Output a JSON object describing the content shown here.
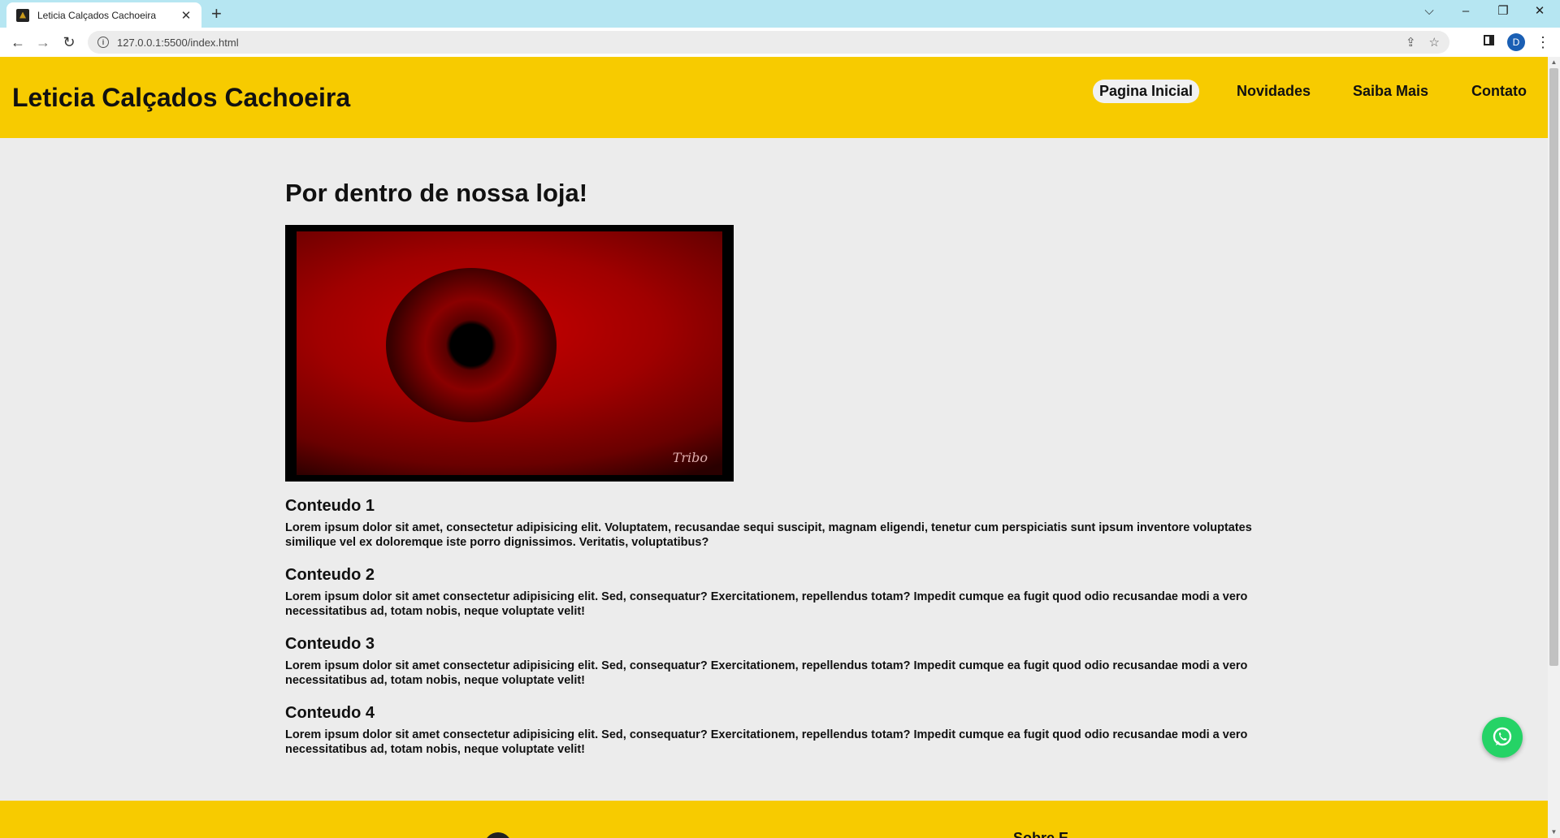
{
  "browser": {
    "tab_title": "Leticia Calçados Cachoeira",
    "tab_close": "✕",
    "new_tab": "+",
    "url": "127.0.0.1:5500/index.html",
    "profile_initial": "D",
    "window_controls": {
      "tab_search": "⌵",
      "minimize": "–",
      "restore": "❐",
      "close": "✕"
    }
  },
  "site": {
    "brand": "Leticia Calçados Cachoeira",
    "nav": [
      {
        "label": "Pagina Inicial",
        "active": true
      },
      {
        "label": "Novidades"
      },
      {
        "label": "Saiba Mais"
      },
      {
        "label": "Contato"
      }
    ]
  },
  "main": {
    "title": "Por dentro de nossa loja!",
    "image_watermark": "Tribo",
    "sections": [
      {
        "heading": "Conteudo 1",
        "text": "Lorem ipsum dolor sit amet, consectetur adipisicing elit. Voluptatem, recusandae sequi suscipit, magnam eligendi, tenetur cum perspiciatis sunt ipsum inventore voluptates similique vel ex doloremque iste porro dignissimos. Veritatis, voluptatibus?"
      },
      {
        "heading": "Conteudo 2",
        "text": "Lorem ipsum dolor sit amet consectetur adipisicing elit. Sed, consequatur? Exercitationem, repellendus totam? Impedit cumque ea fugit quod odio recusandae modi a vero necessitatibus ad, totam nobis, neque voluptate velit!"
      },
      {
        "heading": "Conteudo 3",
        "text": "Lorem ipsum dolor sit amet consectetur adipisicing elit. Sed, consequatur? Exercitationem, repellendus totam? Impedit cumque ea fugit quod odio recusandae modi a vero necessitatibus ad, totam nobis, neque voluptate velit!"
      },
      {
        "heading": "Conteudo 4",
        "text": "Lorem ipsum dolor sit amet consectetur adipisicing elit. Sed, consequatur? Exercitationem, repellendus totam? Impedit cumque ea fugit quod odio recusandae modi a vero necessitatibus ad, totam nobis, neque voluptate velit!"
      }
    ]
  },
  "footer": {
    "partial_text": "Sobre E"
  },
  "colors": {
    "brand_yellow": "#f7cb00",
    "page_bg": "#ececec",
    "whatsapp_green": "#25d366",
    "tab_bar": "#b6e6f2"
  },
  "icons": [
    "back-icon",
    "forward-icon",
    "reload-icon",
    "info-icon",
    "share-icon",
    "star-icon",
    "side-panel-icon",
    "menu-icon",
    "whatsapp-icon"
  ]
}
